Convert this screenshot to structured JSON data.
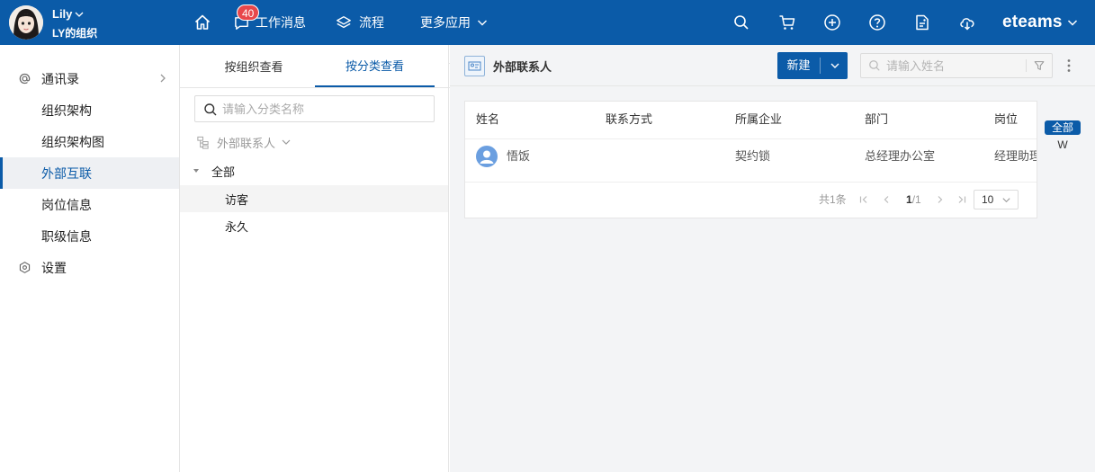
{
  "user": {
    "name": "Lily",
    "org": "LY的组织"
  },
  "nav": [
    {
      "id": "home",
      "label": ""
    },
    {
      "id": "messages",
      "label": "工作消息",
      "badge": "40"
    },
    {
      "id": "flow",
      "label": "流程"
    },
    {
      "id": "more",
      "label": "更多应用"
    }
  ],
  "brand": "eteams",
  "left_menu": {
    "section": "通讯录",
    "items": [
      "组织架构",
      "组织架构图",
      "外部互联",
      "岗位信息",
      "职级信息"
    ],
    "active": "外部互联",
    "settings": "设置"
  },
  "mid": {
    "tabs": [
      "按组织查看",
      "按分类查看"
    ],
    "active_tab": "按分类查看",
    "search_placeholder": "请输入分类名称",
    "category_dropdown": "外部联系人",
    "tree": {
      "root": "全部",
      "children": [
        "访客",
        "永久"
      ],
      "selected": "访客"
    }
  },
  "content": {
    "title": "外部联系人",
    "new_button": "新建",
    "search_placeholder": "请输入姓名",
    "columns": [
      "姓名",
      "联系方式",
      "所属企业",
      "部门",
      "岗位"
    ],
    "rows": [
      {
        "name": "悟饭",
        "contact": "",
        "company": "契约锁",
        "dept": "总经理办公室",
        "position": "经理助理"
      }
    ],
    "pagination": {
      "total": "共1条",
      "page": "1",
      "pages": "1",
      "page_size": "10"
    },
    "alpha_index": [
      "全部",
      "W"
    ]
  },
  "colors": {
    "primary": "#0b5ba8",
    "badge": "#e8474b",
    "content_bg": "#f3f4f6"
  }
}
